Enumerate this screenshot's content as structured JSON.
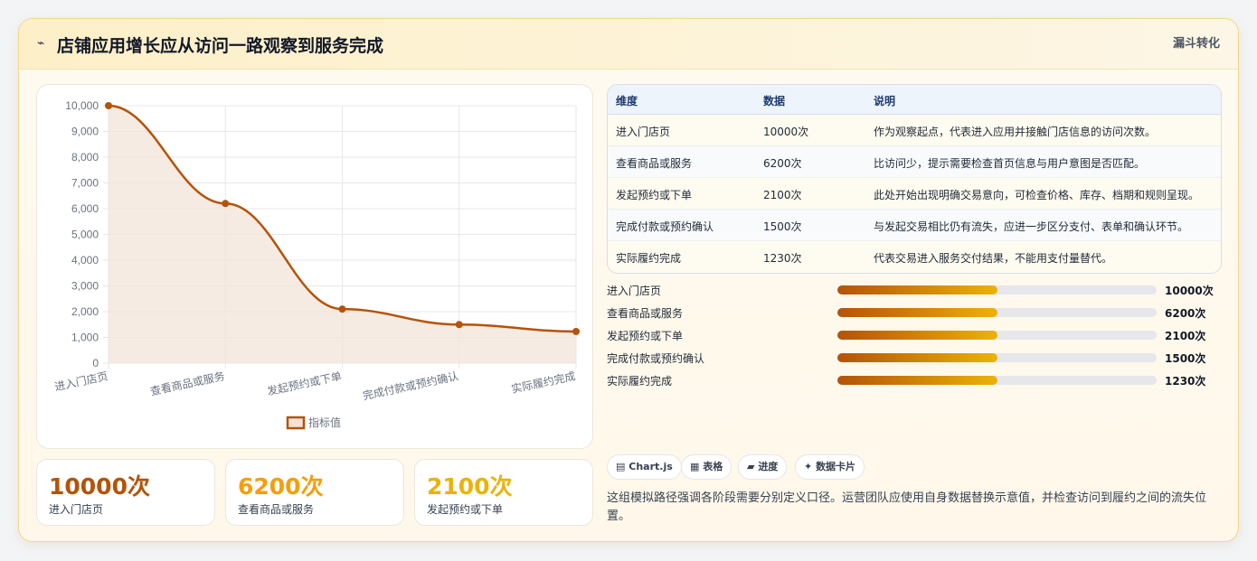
{
  "header": {
    "icon": "chart-spark-icon",
    "title": "店铺应用增长应从访问一路观察到服务完成",
    "tag": "漏斗转化"
  },
  "chart_data": {
    "type": "line",
    "categories": [
      "进入门店页",
      "查看商品或服务",
      "发起预约或下单",
      "完成付款或预约确认",
      "实际履约完成"
    ],
    "series": [
      {
        "name": "指标值",
        "values": [
          10000,
          6200,
          2100,
          1500,
          1230
        ]
      }
    ],
    "y_ticks": [
      "0",
      "1,000",
      "2,000",
      "3,000",
      "4,000",
      "5,000",
      "6,000",
      "7,000",
      "8,000",
      "9,000",
      "10,000"
    ],
    "ylim": [
      0,
      10000
    ],
    "fill": true,
    "grid": true,
    "legend": "bottom",
    "colors": {
      "line": "#b45309",
      "fill": "#f3e4d8"
    }
  },
  "kpis": [
    {
      "value": "10000次",
      "label": "进入门店页",
      "color": "#b45309"
    },
    {
      "value": "6200次",
      "label": "查看商品或服务",
      "color": "#f59e0b"
    },
    {
      "value": "2100次",
      "label": "发起预约或下单",
      "color": "#eab308"
    }
  ],
  "table": {
    "headers": [
      "维度",
      "数据",
      "说明"
    ],
    "rows": [
      [
        "进入门店页",
        "10000次",
        "作为观察起点，代表进入应用并接触门店信息的访问次数。"
      ],
      [
        "查看商品或服务",
        "6200次",
        "比访问少，提示需要检查首页信息与用户意图是否匹配。"
      ],
      [
        "发起预约或下单",
        "2100次",
        "此处开始出现明确交易意向，可检查价格、库存、档期和规则呈现。"
      ],
      [
        "完成付款或预约确认",
        "1500次",
        "与发起交易相比仍有流失，应进一步区分支付、表单和确认环节。"
      ],
      [
        "实际履约完成",
        "1230次",
        "代表交易进入服务交付结果，不能用支付量替代。"
      ]
    ]
  },
  "progress": [
    {
      "label": "进入门店页",
      "value": "10000次",
      "fraction": 0.5
    },
    {
      "label": "查看商品或服务",
      "value": "6200次",
      "fraction": 0.5
    },
    {
      "label": "发起预约或下单",
      "value": "2100次",
      "fraction": 0.5
    },
    {
      "label": "完成付款或预约确认",
      "value": "1500次",
      "fraction": 0.5
    },
    {
      "label": "实际履约完成",
      "value": "1230次",
      "fraction": 0.5
    }
  ],
  "chips": [
    {
      "icon": "chart-icon",
      "glyph": "▤",
      "label": "Chart.js"
    },
    {
      "icon": "table-icon",
      "glyph": "▦",
      "label": "表格"
    },
    {
      "icon": "progress-icon",
      "glyph": "▰",
      "label": "进度"
    },
    {
      "icon": "sparkle-icon",
      "glyph": "✦",
      "label": "数据卡片"
    }
  ],
  "note": "这组模拟路径强调各阶段需要分别定义口径。运营团队应使用自身数据替换示意值，并检查访问到履约之间的流失位置。"
}
